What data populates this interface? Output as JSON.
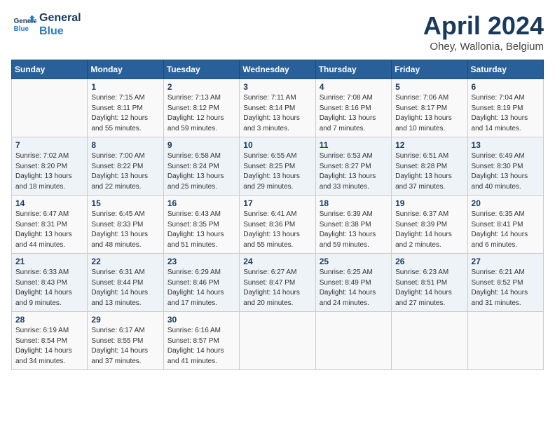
{
  "header": {
    "logo_line1": "General",
    "logo_line2": "Blue",
    "month_title": "April 2024",
    "location": "Ohey, Wallonia, Belgium"
  },
  "days_of_week": [
    "Sunday",
    "Monday",
    "Tuesday",
    "Wednesday",
    "Thursday",
    "Friday",
    "Saturday"
  ],
  "weeks": [
    [
      {
        "day": "",
        "info": ""
      },
      {
        "day": "1",
        "info": "Sunrise: 7:15 AM\nSunset: 8:11 PM\nDaylight: 12 hours\nand 55 minutes."
      },
      {
        "day": "2",
        "info": "Sunrise: 7:13 AM\nSunset: 8:12 PM\nDaylight: 12 hours\nand 59 minutes."
      },
      {
        "day": "3",
        "info": "Sunrise: 7:11 AM\nSunset: 8:14 PM\nDaylight: 13 hours\nand 3 minutes."
      },
      {
        "day": "4",
        "info": "Sunrise: 7:08 AM\nSunset: 8:16 PM\nDaylight: 13 hours\nand 7 minutes."
      },
      {
        "day": "5",
        "info": "Sunrise: 7:06 AM\nSunset: 8:17 PM\nDaylight: 13 hours\nand 10 minutes."
      },
      {
        "day": "6",
        "info": "Sunrise: 7:04 AM\nSunset: 8:19 PM\nDaylight: 13 hours\nand 14 minutes."
      }
    ],
    [
      {
        "day": "7",
        "info": "Sunrise: 7:02 AM\nSunset: 8:20 PM\nDaylight: 13 hours\nand 18 minutes."
      },
      {
        "day": "8",
        "info": "Sunrise: 7:00 AM\nSunset: 8:22 PM\nDaylight: 13 hours\nand 22 minutes."
      },
      {
        "day": "9",
        "info": "Sunrise: 6:58 AM\nSunset: 8:24 PM\nDaylight: 13 hours\nand 25 minutes."
      },
      {
        "day": "10",
        "info": "Sunrise: 6:55 AM\nSunset: 8:25 PM\nDaylight: 13 hours\nand 29 minutes."
      },
      {
        "day": "11",
        "info": "Sunrise: 6:53 AM\nSunset: 8:27 PM\nDaylight: 13 hours\nand 33 minutes."
      },
      {
        "day": "12",
        "info": "Sunrise: 6:51 AM\nSunset: 8:28 PM\nDaylight: 13 hours\nand 37 minutes."
      },
      {
        "day": "13",
        "info": "Sunrise: 6:49 AM\nSunset: 8:30 PM\nDaylight: 13 hours\nand 40 minutes."
      }
    ],
    [
      {
        "day": "14",
        "info": "Sunrise: 6:47 AM\nSunset: 8:31 PM\nDaylight: 13 hours\nand 44 minutes."
      },
      {
        "day": "15",
        "info": "Sunrise: 6:45 AM\nSunset: 8:33 PM\nDaylight: 13 hours\nand 48 minutes."
      },
      {
        "day": "16",
        "info": "Sunrise: 6:43 AM\nSunset: 8:35 PM\nDaylight: 13 hours\nand 51 minutes."
      },
      {
        "day": "17",
        "info": "Sunrise: 6:41 AM\nSunset: 8:36 PM\nDaylight: 13 hours\nand 55 minutes."
      },
      {
        "day": "18",
        "info": "Sunrise: 6:39 AM\nSunset: 8:38 PM\nDaylight: 13 hours\nand 59 minutes."
      },
      {
        "day": "19",
        "info": "Sunrise: 6:37 AM\nSunset: 8:39 PM\nDaylight: 14 hours\nand 2 minutes."
      },
      {
        "day": "20",
        "info": "Sunrise: 6:35 AM\nSunset: 8:41 PM\nDaylight: 14 hours\nand 6 minutes."
      }
    ],
    [
      {
        "day": "21",
        "info": "Sunrise: 6:33 AM\nSunset: 8:43 PM\nDaylight: 14 hours\nand 9 minutes."
      },
      {
        "day": "22",
        "info": "Sunrise: 6:31 AM\nSunset: 8:44 PM\nDaylight: 14 hours\nand 13 minutes."
      },
      {
        "day": "23",
        "info": "Sunrise: 6:29 AM\nSunset: 8:46 PM\nDaylight: 14 hours\nand 17 minutes."
      },
      {
        "day": "24",
        "info": "Sunrise: 6:27 AM\nSunset: 8:47 PM\nDaylight: 14 hours\nand 20 minutes."
      },
      {
        "day": "25",
        "info": "Sunrise: 6:25 AM\nSunset: 8:49 PM\nDaylight: 14 hours\nand 24 minutes."
      },
      {
        "day": "26",
        "info": "Sunrise: 6:23 AM\nSunset: 8:51 PM\nDaylight: 14 hours\nand 27 minutes."
      },
      {
        "day": "27",
        "info": "Sunrise: 6:21 AM\nSunset: 8:52 PM\nDaylight: 14 hours\nand 31 minutes."
      }
    ],
    [
      {
        "day": "28",
        "info": "Sunrise: 6:19 AM\nSunset: 8:54 PM\nDaylight: 14 hours\nand 34 minutes."
      },
      {
        "day": "29",
        "info": "Sunrise: 6:17 AM\nSunset: 8:55 PM\nDaylight: 14 hours\nand 37 minutes."
      },
      {
        "day": "30",
        "info": "Sunrise: 6:16 AM\nSunset: 8:57 PM\nDaylight: 14 hours\nand 41 minutes."
      },
      {
        "day": "",
        "info": ""
      },
      {
        "day": "",
        "info": ""
      },
      {
        "day": "",
        "info": ""
      },
      {
        "day": "",
        "info": ""
      }
    ]
  ]
}
